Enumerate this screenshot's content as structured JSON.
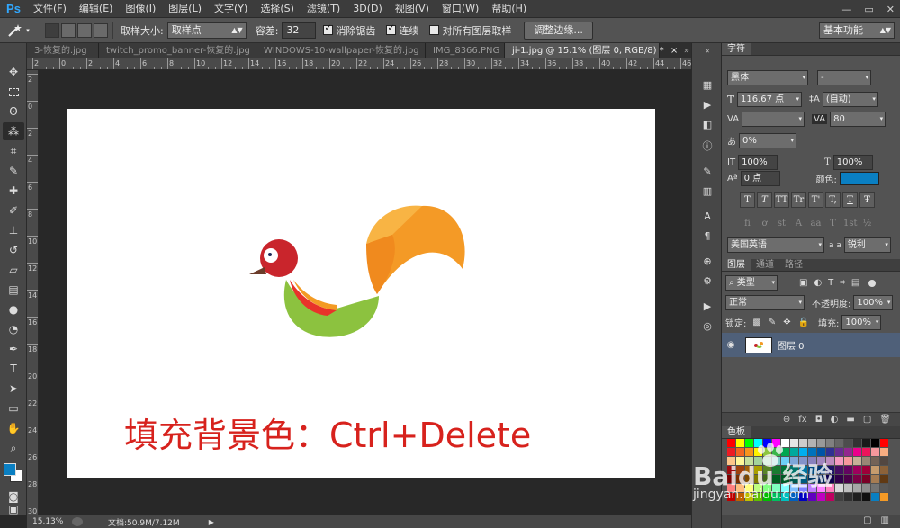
{
  "app": {
    "logo": "Ps",
    "menu": [
      "文件(F)",
      "编辑(E)",
      "图像(I)",
      "图层(L)",
      "文字(Y)",
      "选择(S)",
      "滤镜(T)",
      "3D(D)",
      "视图(V)",
      "窗口(W)",
      "帮助(H)"
    ],
    "window_controls": [
      "—",
      "▭",
      "✕"
    ]
  },
  "options_bar": {
    "tool_icon": "magic-wand-icon",
    "sample_size_label": "取样大小:",
    "sample_size_value": "取样点",
    "tolerance_label": "容差:",
    "tolerance_value": "32",
    "antialias_label": "消除锯齿",
    "antialias_checked": true,
    "contiguous_label": "连续",
    "contiguous_checked": true,
    "all_layers_label": "对所有图层取样",
    "all_layers_checked": false,
    "refine_edge_label": "调整边缘...",
    "workspace_value": "基本功能"
  },
  "tabs": [
    {
      "label": "3-恢复的.jpg",
      "active": false
    },
    {
      "label": "twitch_promo_banner-恢复的.jpg",
      "active": false
    },
    {
      "label": "WINDOWS-10-wallpaper-恢复的.jpg",
      "active": false
    },
    {
      "label": "IMG_8366.PNG",
      "active": false
    },
    {
      "label": "ji-1.jpg @ 15.1% (图层 0, RGB/8) *",
      "active": true
    },
    {
      "label": "×",
      "active": false
    }
  ],
  "tab_overflow": "»",
  "ruler": {
    "top_labels": [
      "2",
      "0",
      "2",
      "4",
      "6",
      "8",
      "10",
      "12",
      "14",
      "16",
      "18",
      "20",
      "22",
      "24",
      "26",
      "28",
      "30",
      "32",
      "34",
      "36",
      "38",
      "40",
      "42",
      "44",
      "46"
    ],
    "left_labels": [
      "2",
      "0",
      "2",
      "4",
      "6",
      "8",
      "10",
      "12",
      "14",
      "16",
      "18",
      "20",
      "22",
      "24",
      "26",
      "28",
      "30"
    ]
  },
  "canvas": {
    "caption": "填充背景色：Ctrl+Delete",
    "caption_color": "#d7221d"
  },
  "status": {
    "zoom": "15.13%",
    "doc_info": "文档:50.9M/7.12M"
  },
  "character_panel": {
    "tab": "字符",
    "font_family": "黑体",
    "font_style": "-",
    "font_size": "116.67 点",
    "leading": "(自动)",
    "kerning": "",
    "tracking": "80",
    "scale_ratio": "0%",
    "vertical_scale": "100%",
    "horizontal_scale": "100%",
    "baseline_shift": "0 点",
    "color_label": "颜色:",
    "text_color": "#0a7fc2",
    "style_buttons": [
      "T",
      "T",
      "TT",
      "Tr",
      "T'",
      "T,",
      "T",
      "Ŧ"
    ],
    "opentype_buttons": [
      "fi",
      "ơ",
      "st",
      "A",
      "aa",
      "T",
      "1st",
      "½"
    ],
    "language": "美国英语",
    "aa_label": "a a",
    "antialias": "锐利"
  },
  "layers_panel": {
    "tabs": [
      "图层",
      "通道",
      "路径"
    ],
    "filter_kind": "类型",
    "blend_mode": "正常",
    "opacity_label": "不透明度:",
    "opacity_value": "100%",
    "lock_label": "锁定:",
    "fill_label": "填充:",
    "fill_value": "100%",
    "layer_name": "图层 0",
    "footer_icons": [
      "link-icon",
      "fx-icon",
      "mask-icon",
      "adjustment-icon",
      "group-icon",
      "new-layer-icon",
      "trash-icon"
    ],
    "footer_labels": [
      "⊖",
      "fx",
      "◘",
      "◐",
      "▬",
      "▢",
      "🗑"
    ]
  },
  "swatches_panel": {
    "tab": "色板"
  },
  "watermark": {
    "line1": "Baidu 经验",
    "line2": "jingyan.baidu.com"
  }
}
